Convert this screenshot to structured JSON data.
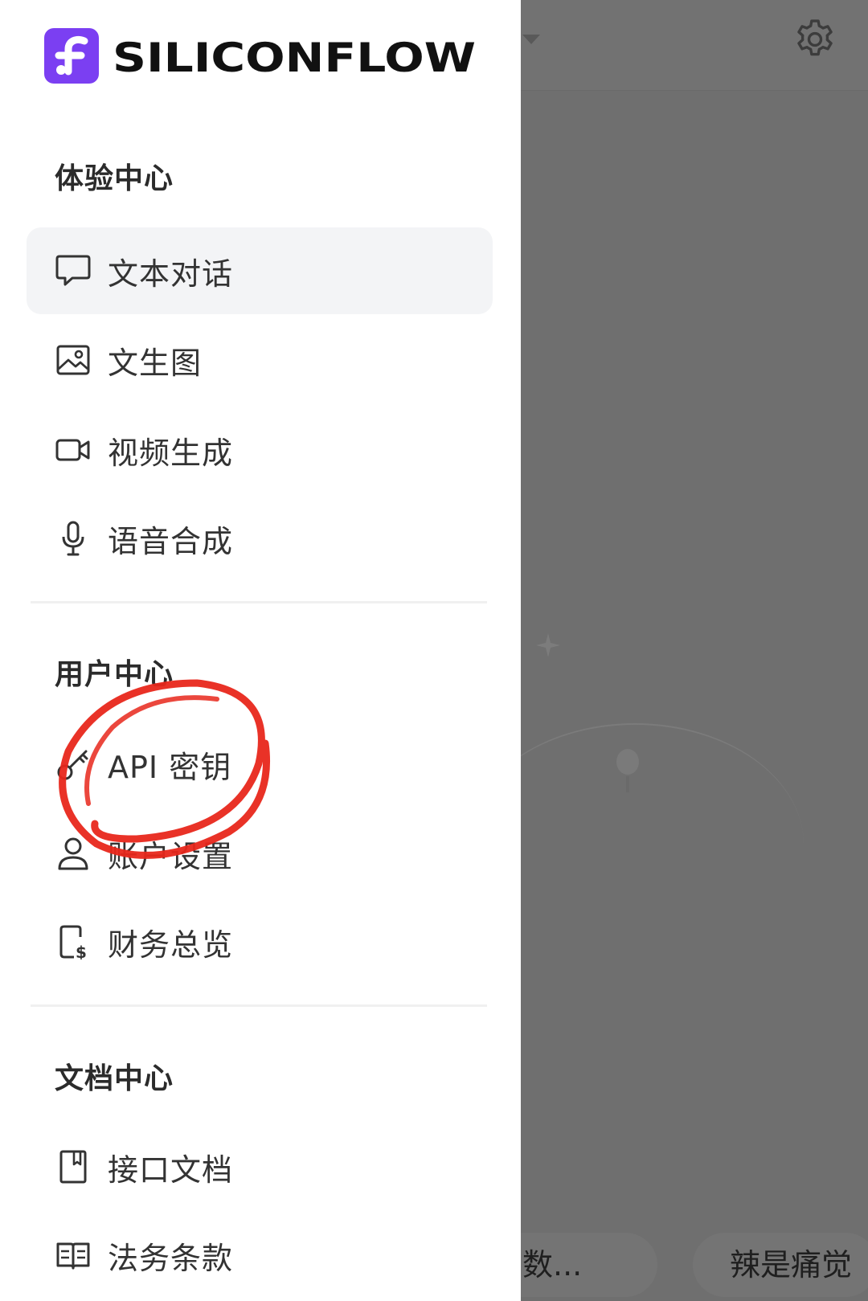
{
  "brand": {
    "name": "SILICONFLOW",
    "accent_color": "#7b3ff2"
  },
  "sections": [
    {
      "title": "体验中心",
      "items": [
        {
          "label": "文本对话",
          "icon": "chat-bubble-icon",
          "active": true
        },
        {
          "label": "文生图",
          "icon": "image-icon"
        },
        {
          "label": "视频生成",
          "icon": "video-camera-icon"
        },
        {
          "label": "语音合成",
          "icon": "microphone-icon"
        }
      ]
    },
    {
      "title": "用户中心",
      "items": [
        {
          "label": "API 密钥",
          "icon": "key-icon"
        },
        {
          "label": "账户设置",
          "icon": "user-icon"
        },
        {
          "label": "财务总览",
          "icon": "billing-phone-icon"
        }
      ]
    },
    {
      "title": "文档中心",
      "items": [
        {
          "label": "接口文档",
          "icon": "bookmark-doc-icon"
        },
        {
          "label": "法务条款",
          "icon": "open-book-icon"
        }
      ]
    }
  ],
  "background": {
    "suggestions": [
      "数...",
      "辣是痛觉"
    ],
    "icons": [
      "dropdown-caret-icon",
      "settings-gear-icon",
      "sparkle-icon",
      "lightbulb-icon"
    ]
  },
  "annotation": {
    "color": "#e8271b",
    "target": "API 密钥"
  }
}
